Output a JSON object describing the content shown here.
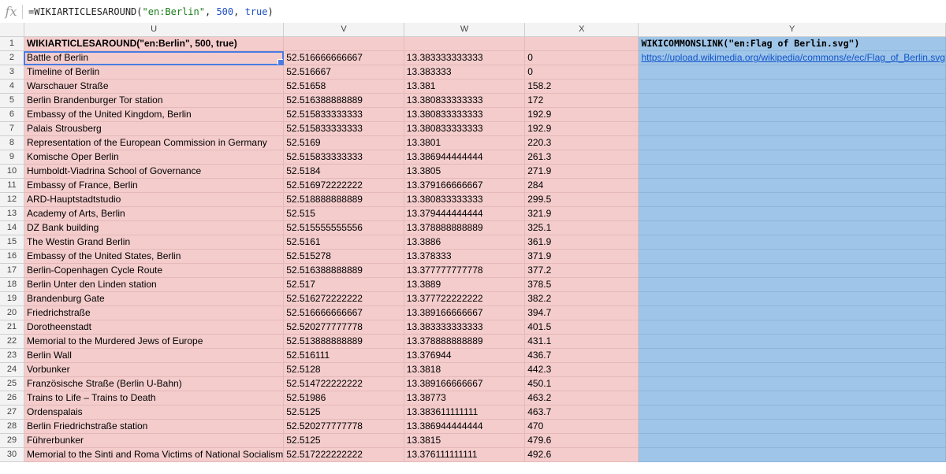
{
  "formula_bar": {
    "icon": "fx-icon",
    "fx_label": "fx",
    "formula_fn": "=WIKIARTICLESAROUND(",
    "formula_arg1": "\"en:Berlin\"",
    "formula_sep1": ", ",
    "formula_arg2": "500",
    "formula_sep2": ", ",
    "formula_arg3": "true",
    "formula_close": ")"
  },
  "columns": [
    "U",
    "V",
    "W",
    "X",
    "Y"
  ],
  "header_row": {
    "row_number": "1",
    "u": "WIKIARTICLESAROUND(\"en:Berlin\", 500, true)",
    "y": "WIKICOMMONSLINK(\"en:Flag of Berlin.svg\")"
  },
  "rows": [
    {
      "n": "2",
      "name": "Battle of Berlin",
      "lat": "52.516666666667",
      "lon": "13.383333333333",
      "dist": "0"
    },
    {
      "n": "3",
      "name": "Timeline of Berlin",
      "lat": "52.516667",
      "lon": "13.383333",
      "dist": "0"
    },
    {
      "n": "4",
      "name": "Warschauer Straße",
      "lat": "52.51658",
      "lon": "13.381",
      "dist": "158.2"
    },
    {
      "n": "5",
      "name": "Berlin Brandenburger Tor station",
      "lat": "52.516388888889",
      "lon": "13.380833333333",
      "dist": "172"
    },
    {
      "n": "6",
      "name": "Embassy of the United Kingdom, Berlin",
      "lat": "52.515833333333",
      "lon": "13.380833333333",
      "dist": "192.9"
    },
    {
      "n": "7",
      "name": "Palais Strousberg",
      "lat": "52.515833333333",
      "lon": "13.380833333333",
      "dist": "192.9"
    },
    {
      "n": "8",
      "name": "Representation of the European Commission in Germany",
      "lat": "52.5169",
      "lon": "13.3801",
      "dist": "220.3"
    },
    {
      "n": "9",
      "name": "Komische Oper Berlin",
      "lat": "52.515833333333",
      "lon": "13.386944444444",
      "dist": "261.3"
    },
    {
      "n": "10",
      "name": "Humboldt-Viadrina School of Governance",
      "lat": "52.5184",
      "lon": "13.3805",
      "dist": "271.9"
    },
    {
      "n": "11",
      "name": "Embassy of France, Berlin",
      "lat": "52.516972222222",
      "lon": "13.379166666667",
      "dist": "284"
    },
    {
      "n": "12",
      "name": "ARD-Hauptstadtstudio",
      "lat": "52.518888888889",
      "lon": "13.380833333333",
      "dist": "299.5"
    },
    {
      "n": "13",
      "name": "Academy of Arts, Berlin",
      "lat": "52.515",
      "lon": "13.379444444444",
      "dist": "321.9"
    },
    {
      "n": "14",
      "name": "DZ Bank building",
      "lat": "52.515555555556",
      "lon": "13.378888888889",
      "dist": "325.1"
    },
    {
      "n": "15",
      "name": "The Westin Grand Berlin",
      "lat": "52.5161",
      "lon": "13.3886",
      "dist": "361.9"
    },
    {
      "n": "16",
      "name": "Embassy of the United States, Berlin",
      "lat": "52.515278",
      "lon": "13.378333",
      "dist": "371.9"
    },
    {
      "n": "17",
      "name": "Berlin-Copenhagen Cycle Route",
      "lat": "52.516388888889",
      "lon": "13.377777777778",
      "dist": "377.2"
    },
    {
      "n": "18",
      "name": "Berlin Unter den Linden station",
      "lat": "52.517",
      "lon": "13.3889",
      "dist": "378.5"
    },
    {
      "n": "19",
      "name": "Brandenburg Gate",
      "lat": "52.516272222222",
      "lon": "13.377722222222",
      "dist": "382.2"
    },
    {
      "n": "20",
      "name": "Friedrichstraße",
      "lat": "52.516666666667",
      "lon": "13.389166666667",
      "dist": "394.7"
    },
    {
      "n": "21",
      "name": "Dorotheenstadt",
      "lat": "52.520277777778",
      "lon": "13.383333333333",
      "dist": "401.5"
    },
    {
      "n": "22",
      "name": "Memorial to the Murdered Jews of Europe",
      "lat": "52.513888888889",
      "lon": "13.378888888889",
      "dist": "431.1"
    },
    {
      "n": "23",
      "name": "Berlin Wall",
      "lat": "52.516111",
      "lon": "13.376944",
      "dist": "436.7"
    },
    {
      "n": "24",
      "name": "Vorbunker",
      "lat": "52.5128",
      "lon": "13.3818",
      "dist": "442.3"
    },
    {
      "n": "25",
      "name": "Französische Straße (Berlin U-Bahn)",
      "lat": "52.514722222222",
      "lon": "13.389166666667",
      "dist": "450.1"
    },
    {
      "n": "26",
      "name": "Trains to Life – Trains to Death",
      "lat": "52.51986",
      "lon": "13.38773",
      "dist": "463.2"
    },
    {
      "n": "27",
      "name": "Ordenspalais",
      "lat": "52.5125",
      "lon": "13.383611111111",
      "dist": "463.7"
    },
    {
      "n": "28",
      "name": "Berlin Friedrichstraße station",
      "lat": "52.520277777778",
      "lon": "13.386944444444",
      "dist": "470"
    },
    {
      "n": "29",
      "name": "Führerbunker",
      "lat": "52.5125",
      "lon": "13.3815",
      "dist": "479.6"
    },
    {
      "n": "30",
      "name": "Memorial to the Sinti and Roma Victims of National Socialism",
      "lat": "52.517222222222",
      "lon": "13.376111111111",
      "dist": "492.6"
    }
  ],
  "link_cell": "https://upload.wikimedia.org/wikipedia/commons/e/ec/Flag_of_Berlin.svg",
  "colors": {
    "pink_fill": "#f4cccc",
    "blue_fill": "#9fc5e8",
    "selection": "#4a7de2",
    "link": "#1155cc"
  }
}
